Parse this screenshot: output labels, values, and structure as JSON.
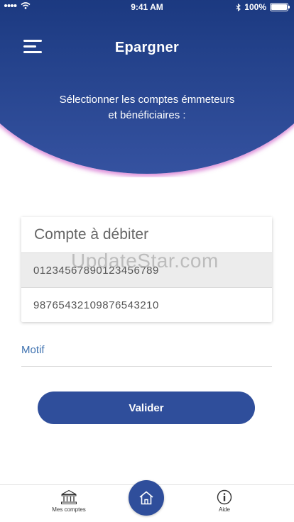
{
  "status_bar": {
    "time": "9:41 AM",
    "battery": "100%"
  },
  "header": {
    "title": "Epargner",
    "subtitle_line1": "Sélectionner les comptes émmeteurs",
    "subtitle_line2": "et bénéficiaires :"
  },
  "dropdown": {
    "placeholder": "Compte à débiter",
    "options": [
      "01234567890123456789",
      "98765432109876543210"
    ],
    "selected_index": 0
  },
  "watermark": "UpdateStar.com",
  "motif": {
    "label": "Motif"
  },
  "actions": {
    "submit_label": "Valider"
  },
  "bottom_nav": {
    "accounts_label": "Mes comptes",
    "help_label": "Aide"
  },
  "colors": {
    "primary": "#2f4e9b",
    "header_dark": "#0d2a6e",
    "link_blue": "#3f72b0",
    "glow": "#c43cbe"
  },
  "icons": [
    "menu-icon",
    "bank-icon",
    "home-icon",
    "info-icon",
    "wifi-icon",
    "signal-icon",
    "bluetooth-icon",
    "battery-icon"
  ]
}
